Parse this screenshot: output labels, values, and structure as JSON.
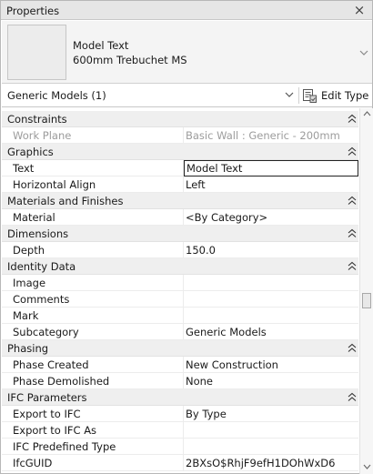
{
  "panel": {
    "title": "Properties",
    "close_glyph": "×"
  },
  "type_selector": {
    "family": "Model Text",
    "type_name": "600mm Trebuchet MS",
    "icon": "chevron-down-icon"
  },
  "filter": {
    "label": "Generic Models (1)",
    "edit_type_label": "Edit Type"
  },
  "groups": [
    {
      "name": "Constraints",
      "rows": [
        {
          "name": "Work Plane",
          "value": "Basic Wall : Generic - 200mm",
          "disabled": true
        }
      ]
    },
    {
      "name": "Graphics",
      "rows": [
        {
          "name": "Text",
          "value": "Model Text",
          "editing": true
        },
        {
          "name": "Horizontal Align",
          "value": "Left"
        }
      ]
    },
    {
      "name": "Materials and Finishes",
      "rows": [
        {
          "name": "Material",
          "value": "<By Category>"
        }
      ]
    },
    {
      "name": "Dimensions",
      "rows": [
        {
          "name": "Depth",
          "value": "150.0"
        }
      ]
    },
    {
      "name": "Identity Data",
      "rows": [
        {
          "name": "Image",
          "value": ""
        },
        {
          "name": "Comments",
          "value": ""
        },
        {
          "name": "Mark",
          "value": ""
        },
        {
          "name": "Subcategory",
          "value": "Generic Models"
        }
      ]
    },
    {
      "name": "Phasing",
      "rows": [
        {
          "name": "Phase Created",
          "value": "New Construction"
        },
        {
          "name": "Phase Demolished",
          "value": "None"
        }
      ]
    },
    {
      "name": "IFC Parameters",
      "rows": [
        {
          "name": "Export to IFC",
          "value": "By Type"
        },
        {
          "name": "Export to IFC As",
          "value": ""
        },
        {
          "name": "IFC Predefined Type",
          "value": ""
        },
        {
          "name": "IfcGUID",
          "value": "2BXsO$RhjF9efH1DOhWxD6"
        }
      ]
    }
  ],
  "colors": {
    "group_bg": "#efefef",
    "disabled_text": "#9c9c9c",
    "title_bg": "#e6e6e6"
  }
}
